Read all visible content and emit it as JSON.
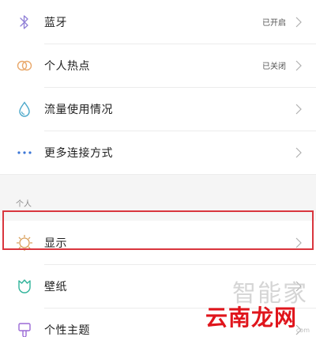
{
  "network_items": [
    {
      "label": "蓝牙",
      "status": "已开启",
      "icon": "bluetooth-icon"
    },
    {
      "label": "个人热点",
      "status": "已关闭",
      "icon": "hotspot-icon"
    },
    {
      "label": "流量使用情况",
      "status": "",
      "icon": "data-usage-icon"
    },
    {
      "label": "更多连接方式",
      "status": "",
      "icon": "more-dots-icon"
    }
  ],
  "personal_section": {
    "header": "个人",
    "items": [
      {
        "label": "显示",
        "status": "",
        "icon": "display-brightness-icon",
        "highlighted": true
      },
      {
        "label": "壁纸",
        "status": "",
        "icon": "wallpaper-tulip-icon"
      },
      {
        "label": "个性主题",
        "status": "",
        "icon": "theme-brush-icon"
      }
    ]
  },
  "watermark": {
    "top_text": "智能家",
    "bottom_text": "云南龙网",
    "sub_text": "com"
  },
  "colors": {
    "icon_bluetooth": "#8f7fd6",
    "icon_hotspot": "#e9a86b",
    "icon_data": "#4aa7c9",
    "icon_more": "#3b76d6",
    "icon_display": "#d9a05b",
    "icon_wallpaper": "#2fb39a",
    "icon_theme": "#9b6ad6",
    "highlight_border": "#d9363e",
    "watermark_red": "#e0151c"
  }
}
